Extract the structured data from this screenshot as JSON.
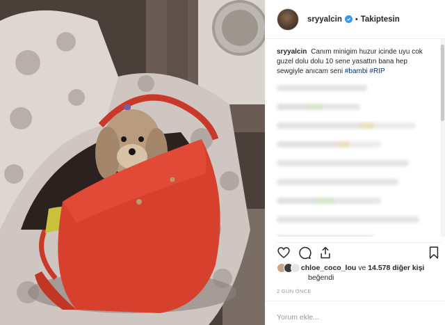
{
  "post": {
    "username": "sryyalcin",
    "follow_state": "Takiptesin",
    "separator": "•",
    "caption_user": "sryyalcin",
    "caption_text": "Canım minigim huzur icinde uyu cok guzel dolu dolu 10 sene yasattın bana hep sewgiyle anıcam seni",
    "hashtags": [
      "#bambi",
      "#RIP"
    ]
  },
  "likes": {
    "user": "chloe_coco_lou",
    "connector": "ve",
    "count": "14.578 diğer kişi",
    "suffix": "beğendi"
  },
  "timestamp": "2 GÜN ÖNCE",
  "comment_box": {
    "placeholder": "Yorum ekle..."
  },
  "icons": {
    "verified": "verified-badge-icon",
    "like": "heart-icon",
    "comment": "comment-bubble-icon",
    "share": "share-icon",
    "save": "bookmark-icon"
  },
  "colors": {
    "bag": "#d8402e",
    "hashtag": "#003569",
    "verified": "#3897f0"
  }
}
